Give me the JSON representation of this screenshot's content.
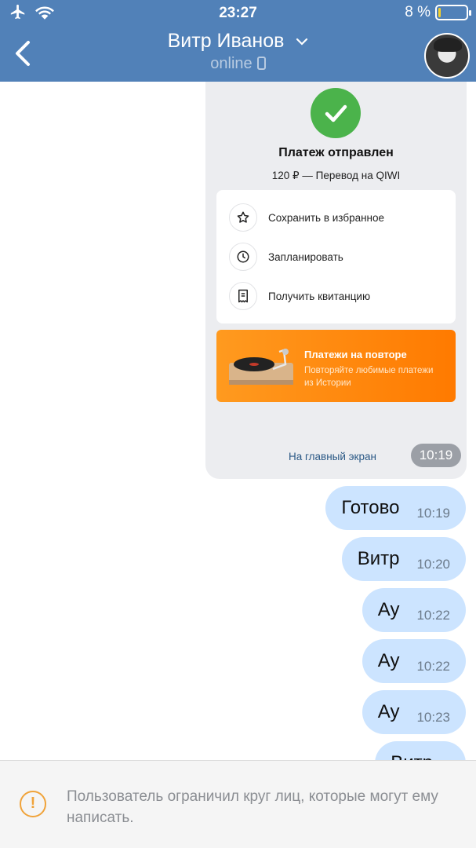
{
  "status_bar": {
    "time": "23:27",
    "battery_percent": "8 %",
    "battery_level": 0.08
  },
  "header": {
    "title": "Витр Иванов",
    "subtitle": "online",
    "back_icon": "chevron-left-icon",
    "title_chevron_icon": "chevron-down-icon",
    "colors": {
      "bar": "#5181b8"
    }
  },
  "payment_card": {
    "title": "Платеж отправлен",
    "subtitle": "120 ₽ — Перевод на QIWI",
    "actions": [
      {
        "label": "Сохранить в избранное",
        "icon": "star-icon"
      },
      {
        "label": "Запланировать",
        "icon": "clock-icon"
      },
      {
        "label": "Получить квитанцию",
        "icon": "receipt-icon"
      }
    ],
    "banner": {
      "title": "Платежи на повторе",
      "subtitle": "Повторяйте любимые платежи из Истории"
    },
    "link": "На главный экран",
    "time": "10:19"
  },
  "messages": [
    {
      "text": "Готово",
      "time": "10:19"
    },
    {
      "text": "Витр",
      "time": "10:20"
    },
    {
      "text": "Ау",
      "time": "10:22"
    },
    {
      "text": "Ау",
      "time": "10:22"
    },
    {
      "text": "Ау",
      "time": "10:23"
    },
    {
      "text": "Витр",
      "time": ""
    }
  ],
  "notice": {
    "text": "Пользователь ограничил круг лиц, которые могут ему написать."
  }
}
